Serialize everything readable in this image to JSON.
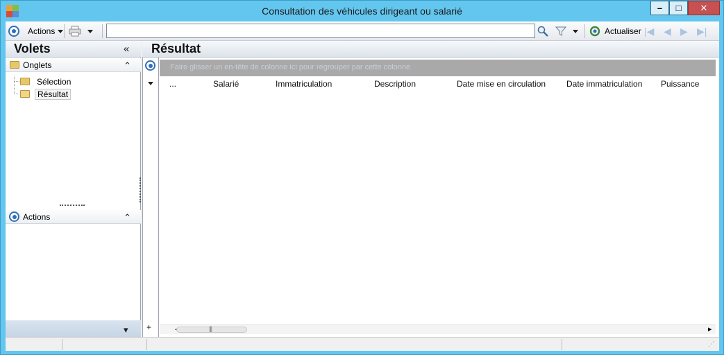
{
  "window": {
    "title": "Consultation des véhicules dirigeant ou salarié",
    "minimize_glyph": "–",
    "maximize_glyph": "□",
    "close_glyph": "✕"
  },
  "toolbar": {
    "actions_label": "Actions",
    "search_value": "",
    "refresh_label": "Actualiser"
  },
  "left_panel": {
    "title": "Volets",
    "collapse_glyph": "«",
    "onglets_label": "Onglets",
    "onglets_chevron": "⌃",
    "tree": [
      {
        "label": "Sélection"
      },
      {
        "label": "Résultat"
      }
    ],
    "actions_label": "Actions",
    "actions_chevron": "⌃",
    "footer_glyph": "▾"
  },
  "result": {
    "title": "Résultat",
    "group_hint": "Faire glisser un en-tête de colonne ici pour regrouper par cette colonne",
    "columns": [
      "...",
      "Salarié",
      "Immatriculation",
      "Description",
      "Date mise en circulation",
      "Date immatriculation",
      "Puissance"
    ],
    "add_glyph": "+",
    "scroll_left": "◂",
    "scroll_right": "▸"
  },
  "colors": {
    "frame": "#63c6ee",
    "accent_blue": "#2f6fba",
    "group_panel": "#a9a9a9"
  }
}
